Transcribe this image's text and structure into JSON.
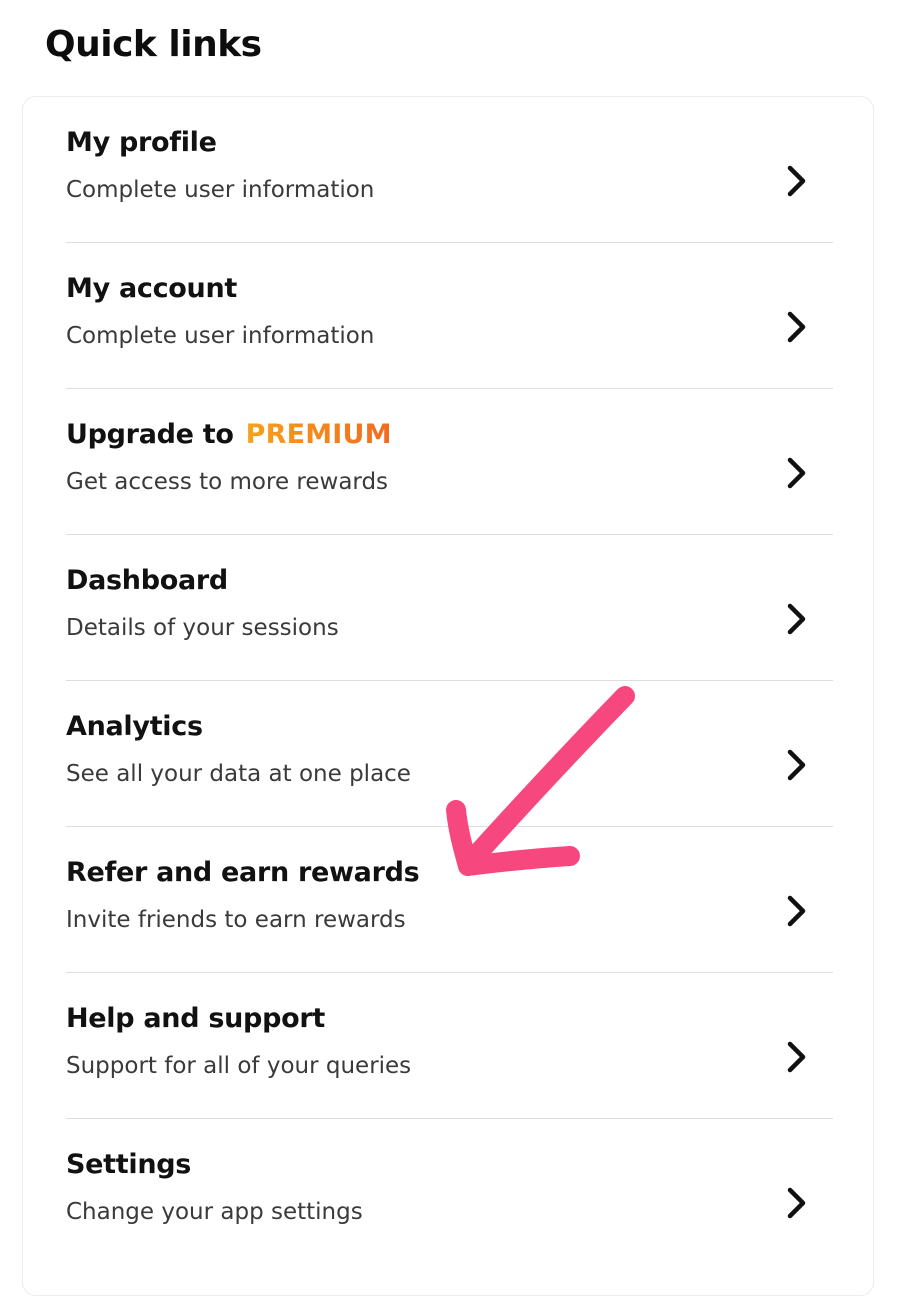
{
  "header": {
    "title": "Quick links"
  },
  "quick_links": [
    {
      "id": "my-profile",
      "title": "My profile",
      "subtitle": "Complete user information"
    },
    {
      "id": "my-account",
      "title": "My account",
      "subtitle": "Complete user information"
    },
    {
      "id": "upgrade-premium",
      "title": "Upgrade to",
      "badge": "PREMIUM",
      "subtitle": "Get access to more rewards"
    },
    {
      "id": "dashboard",
      "title": "Dashboard",
      "subtitle": "Details of your sessions"
    },
    {
      "id": "analytics",
      "title": "Analytics",
      "subtitle": "See all your data at one place"
    },
    {
      "id": "refer-earn",
      "title": "Refer and earn rewards",
      "subtitle": "Invite friends to earn rewards"
    },
    {
      "id": "help-support",
      "title": "Help and support",
      "subtitle": "Support for all of your queries"
    },
    {
      "id": "settings",
      "title": "Settings",
      "subtitle": "Change your app settings"
    }
  ],
  "icons": {
    "row_chevron": "chevron-right-icon",
    "annotation": "hand-drawn-arrow-icon"
  },
  "colors": {
    "premium_gradient_start": "#f7a21b",
    "premium_gradient_end": "#f26a1f",
    "annotation_arrow": "#f7477f",
    "divider": "#dedede"
  }
}
